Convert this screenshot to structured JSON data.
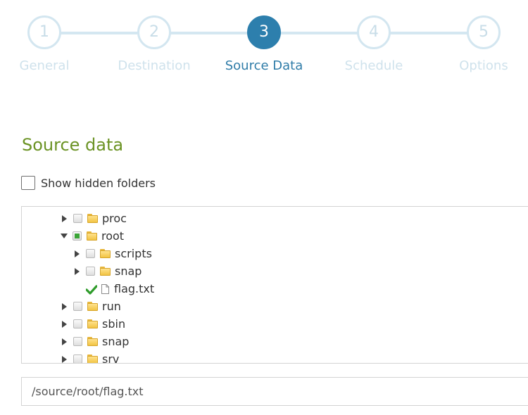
{
  "wizard": {
    "steps": [
      {
        "number": "1",
        "label": "General"
      },
      {
        "number": "2",
        "label": "Destination"
      },
      {
        "number": "3",
        "label": "Source Data"
      },
      {
        "number": "4",
        "label": "Schedule"
      },
      {
        "number": "5",
        "label": "Options"
      }
    ],
    "active_step": 3
  },
  "section": {
    "title": "Source data",
    "show_hidden_label": "Show hidden folders",
    "show_hidden_checked": false
  },
  "tree": {
    "items": [
      {
        "label": "proc",
        "expander": "collapsed",
        "check": "unchecked",
        "icon": "folder-icon"
      },
      {
        "label": "root",
        "expander": "expanded",
        "check": "partial",
        "icon": "folder-icon"
      },
      {
        "label": "scripts",
        "expander": "collapsed",
        "check": "unchecked",
        "icon": "folder-icon"
      },
      {
        "label": "snap",
        "expander": "collapsed",
        "check": "unchecked",
        "icon": "folder-icon"
      },
      {
        "label": "flag.txt",
        "expander": "none",
        "check": "checked",
        "icon": "file-icon"
      },
      {
        "label": "run",
        "expander": "collapsed",
        "check": "unchecked",
        "icon": "folder-icon"
      },
      {
        "label": "sbin",
        "expander": "collapsed",
        "check": "unchecked",
        "icon": "folder-icon"
      },
      {
        "label": "snap",
        "expander": "collapsed",
        "check": "unchecked",
        "icon": "folder-icon"
      },
      {
        "label": "srv",
        "expander": "collapsed",
        "check": "unchecked",
        "icon": "folder-icon"
      }
    ]
  },
  "path_field": {
    "value": "/source/root/flag.txt"
  },
  "colors": {
    "accent": "#2d7fad",
    "inactive_step": "#d3e6f0",
    "section_title": "#6b9324",
    "partial_check": "#3aa536"
  }
}
